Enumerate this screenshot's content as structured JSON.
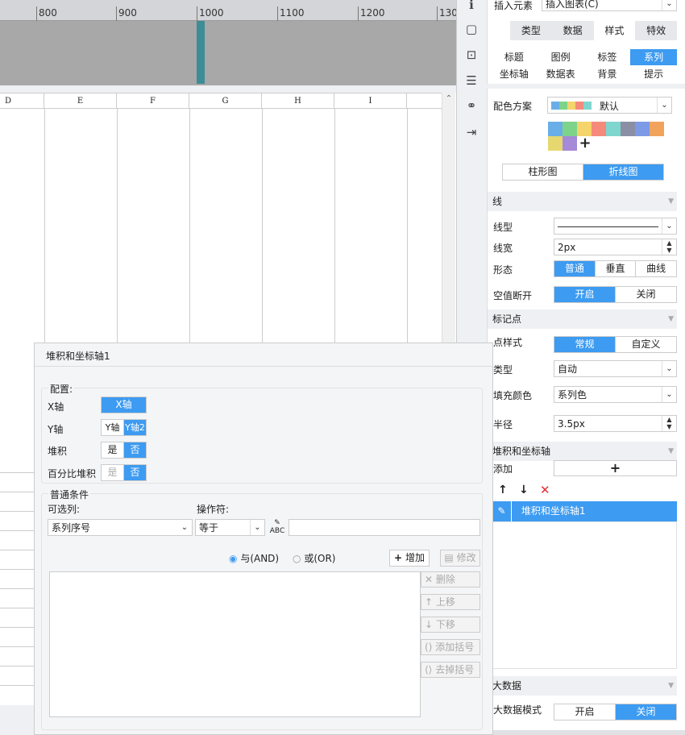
{
  "ruler": {
    "ticks": [
      "800",
      "900",
      "1000",
      "1100",
      "1200",
      "130"
    ]
  },
  "sheet": {
    "columns": [
      "D",
      "E",
      "F",
      "G",
      "H",
      "I"
    ]
  },
  "panel": {
    "insert_label": "插入元素",
    "insert_value": "插入图表(C)",
    "tabs": [
      "类型",
      "数据",
      "样式",
      "特效"
    ],
    "subtabs_row1": [
      "标题",
      "图例",
      "标签",
      "系列"
    ],
    "subtabs_row2": [
      "坐标轴",
      "数据表",
      "背景",
      "提示"
    ],
    "color_scheme_label": "配色方案",
    "color_scheme_value": "默认",
    "swatches": [
      "#6aaee8",
      "#7dd38a",
      "#f4d46b",
      "#f58a7a",
      "#7fd6cf",
      "#8a8fa6",
      "#7c9ae6",
      "#f2a35b",
      "#e6d86f",
      "#a58ad8"
    ],
    "chart_types": [
      "柱形图",
      "折线图"
    ],
    "section_line": "线",
    "line_type_label": "线型",
    "line_width_label": "线宽",
    "line_width_value": "2px",
    "shape_label": "形态",
    "shapes": [
      "普通",
      "垂直",
      "曲线"
    ],
    "null_break_label": "空值断开",
    "on": "开启",
    "off": "关闭",
    "section_marker": "标记点",
    "point_style_label": "点样式",
    "point_styles": [
      "常规",
      "自定义"
    ],
    "type_label": "类型",
    "type_value": "自动",
    "fill_label": "填充颜色",
    "fill_value": "系列色",
    "radius_label": "半径",
    "radius_value": "3.5px",
    "section_stack": "堆积和坐标轴",
    "add_label": "添加",
    "stack_item": "堆积和坐标轴1",
    "section_bigdata": "大数据",
    "bigdata_label": "大数据模式"
  },
  "dialog": {
    "title": "堆积和坐标轴1",
    "config_label": "配置:",
    "xaxis_label": "X轴",
    "xaxis_value": "X轴",
    "yaxis_label": "Y轴",
    "yaxis_opts": [
      "Y轴",
      "Y轴2"
    ],
    "stack_label": "堆积",
    "yes": "是",
    "no": "否",
    "pct_label": "百分比堆积",
    "cond_label": "普通条件",
    "col_label": "可选列:",
    "col_value": "系列序号",
    "op_label": "操作符:",
    "op_value": "等于",
    "and_label": "与(AND)",
    "or_label": "或(OR)",
    "add_btn": "增加",
    "edit_btn": "修改",
    "del_btn": "删除",
    "up_btn": "上移",
    "down_btn": "下移",
    "addparen_btn": "添加括号",
    "rmparen_btn": "去掉括号"
  }
}
